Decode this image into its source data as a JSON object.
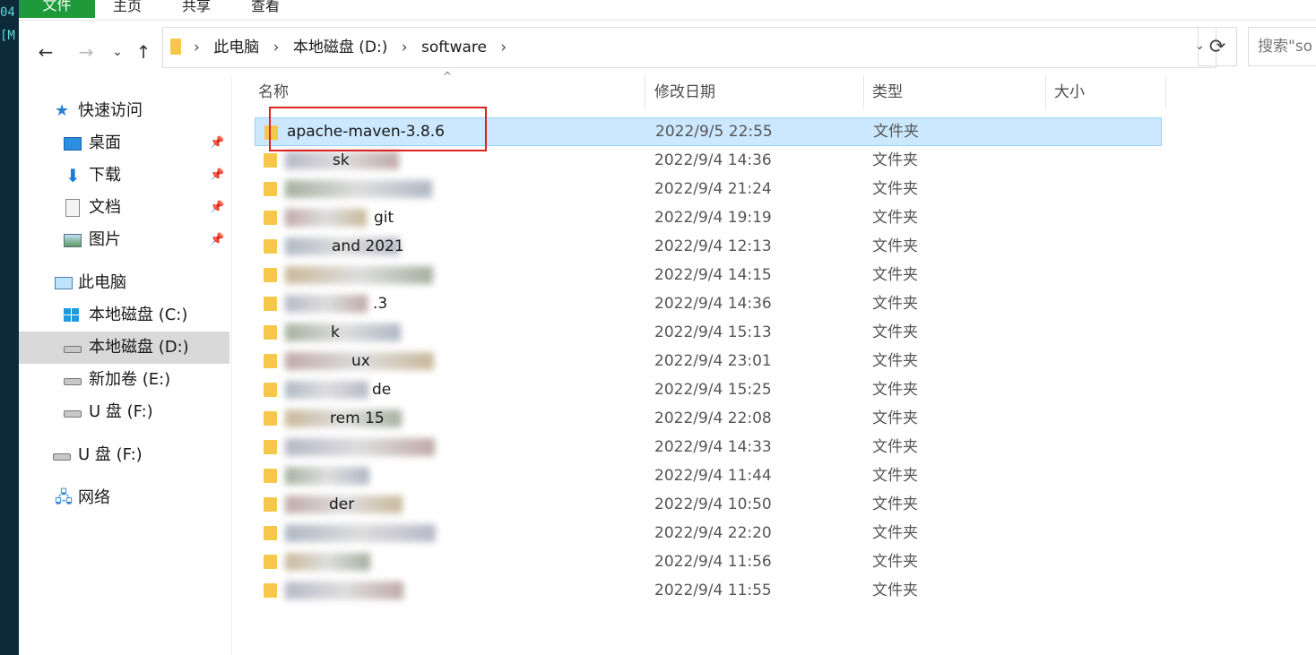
{
  "terminal": {
    "line1": "04",
    "line2": "[M"
  },
  "ribbon": {
    "tabs": [
      "文件",
      "主页",
      "共享",
      "查看"
    ]
  },
  "nav": {
    "back": "←",
    "forward": "→",
    "recent": "⌄",
    "up": "↑"
  },
  "address": {
    "crumbs": [
      "此电脑",
      "本地磁盘 (D:)",
      "software"
    ],
    "separator": "›",
    "dropdown": "⌄"
  },
  "refresh": "⟳",
  "search": {
    "placeholder": "搜索\"so"
  },
  "sidebar": {
    "items": [
      {
        "label": "快速访问",
        "icon": "star-icon",
        "pinned": false
      },
      {
        "label": "桌面",
        "icon": "desktop-icon",
        "pinned": true
      },
      {
        "label": "下载",
        "icon": "download-icon",
        "pinned": true
      },
      {
        "label": "文档",
        "icon": "document-icon",
        "pinned": true
      },
      {
        "label": "图片",
        "icon": "pictures-icon",
        "pinned": true
      },
      {
        "label": "此电脑",
        "icon": "computer-icon",
        "pinned": false
      },
      {
        "label": "本地磁盘 (C:)",
        "icon": "drive-c-icon",
        "pinned": false
      },
      {
        "label": "本地磁盘 (D:)",
        "icon": "drive-icon",
        "pinned": false,
        "selected": true
      },
      {
        "label": "新加卷 (E:)",
        "icon": "drive-icon",
        "pinned": false
      },
      {
        "label": "U 盘 (F:)",
        "icon": "usb-drive-icon",
        "pinned": false
      },
      {
        "label": "U 盘 (F:)",
        "icon": "usb-drive-icon",
        "pinned": false
      },
      {
        "label": "网络",
        "icon": "network-icon",
        "pinned": false
      }
    ],
    "pin_glyph": "📌"
  },
  "columns": {
    "name": "名称",
    "modified": "修改日期",
    "type": "类型",
    "size": "大小",
    "sort_glyph": "^"
  },
  "files": [
    {
      "name": "apache-maven-3.8.6",
      "date": "2022/9/5 22:55",
      "type": "文件夹",
      "selected": true
    },
    {
      "name": "sk",
      "date": "2022/9/4 14:36",
      "type": "文件夹"
    },
    {
      "name": "",
      "date": "2022/9/4 21:24",
      "type": "文件夹"
    },
    {
      "name": "git",
      "date": "2022/9/4 19:19",
      "type": "文件夹"
    },
    {
      "name": "and 2021",
      "date": "2022/9/4 12:13",
      "type": "文件夹"
    },
    {
      "name": "",
      "date": "2022/9/4 14:15",
      "type": "文件夹"
    },
    {
      "name": ".3",
      "date": "2022/9/4 14:36",
      "type": "文件夹"
    },
    {
      "name": "k",
      "date": "2022/9/4 15:13",
      "type": "文件夹"
    },
    {
      "name": "ux",
      "date": "2022/9/4 23:01",
      "type": "文件夹"
    },
    {
      "name": "de",
      "date": "2022/9/4 15:25",
      "type": "文件夹"
    },
    {
      "name": "rem 15",
      "date": "2022/9/4 22:08",
      "type": "文件夹"
    },
    {
      "name": "",
      "date": "2022/9/4 14:33",
      "type": "文件夹"
    },
    {
      "name": "",
      "date": "2022/9/4 11:44",
      "type": "文件夹"
    },
    {
      "name": "der",
      "date": "2022/9/4 10:50",
      "type": "文件夹"
    },
    {
      "name": "",
      "date": "2022/9/4 22:20",
      "type": "文件夹"
    },
    {
      "name": "",
      "date": "2022/9/4 11:56",
      "type": "文件夹"
    },
    {
      "name": "",
      "date": "2022/9/4 11:55",
      "type": "文件夹"
    }
  ],
  "colors": {
    "selection": "#cce8ff",
    "highlight_box": "#e02020",
    "file_tab": "#1e9a3a",
    "folder": "#f5c84c"
  }
}
